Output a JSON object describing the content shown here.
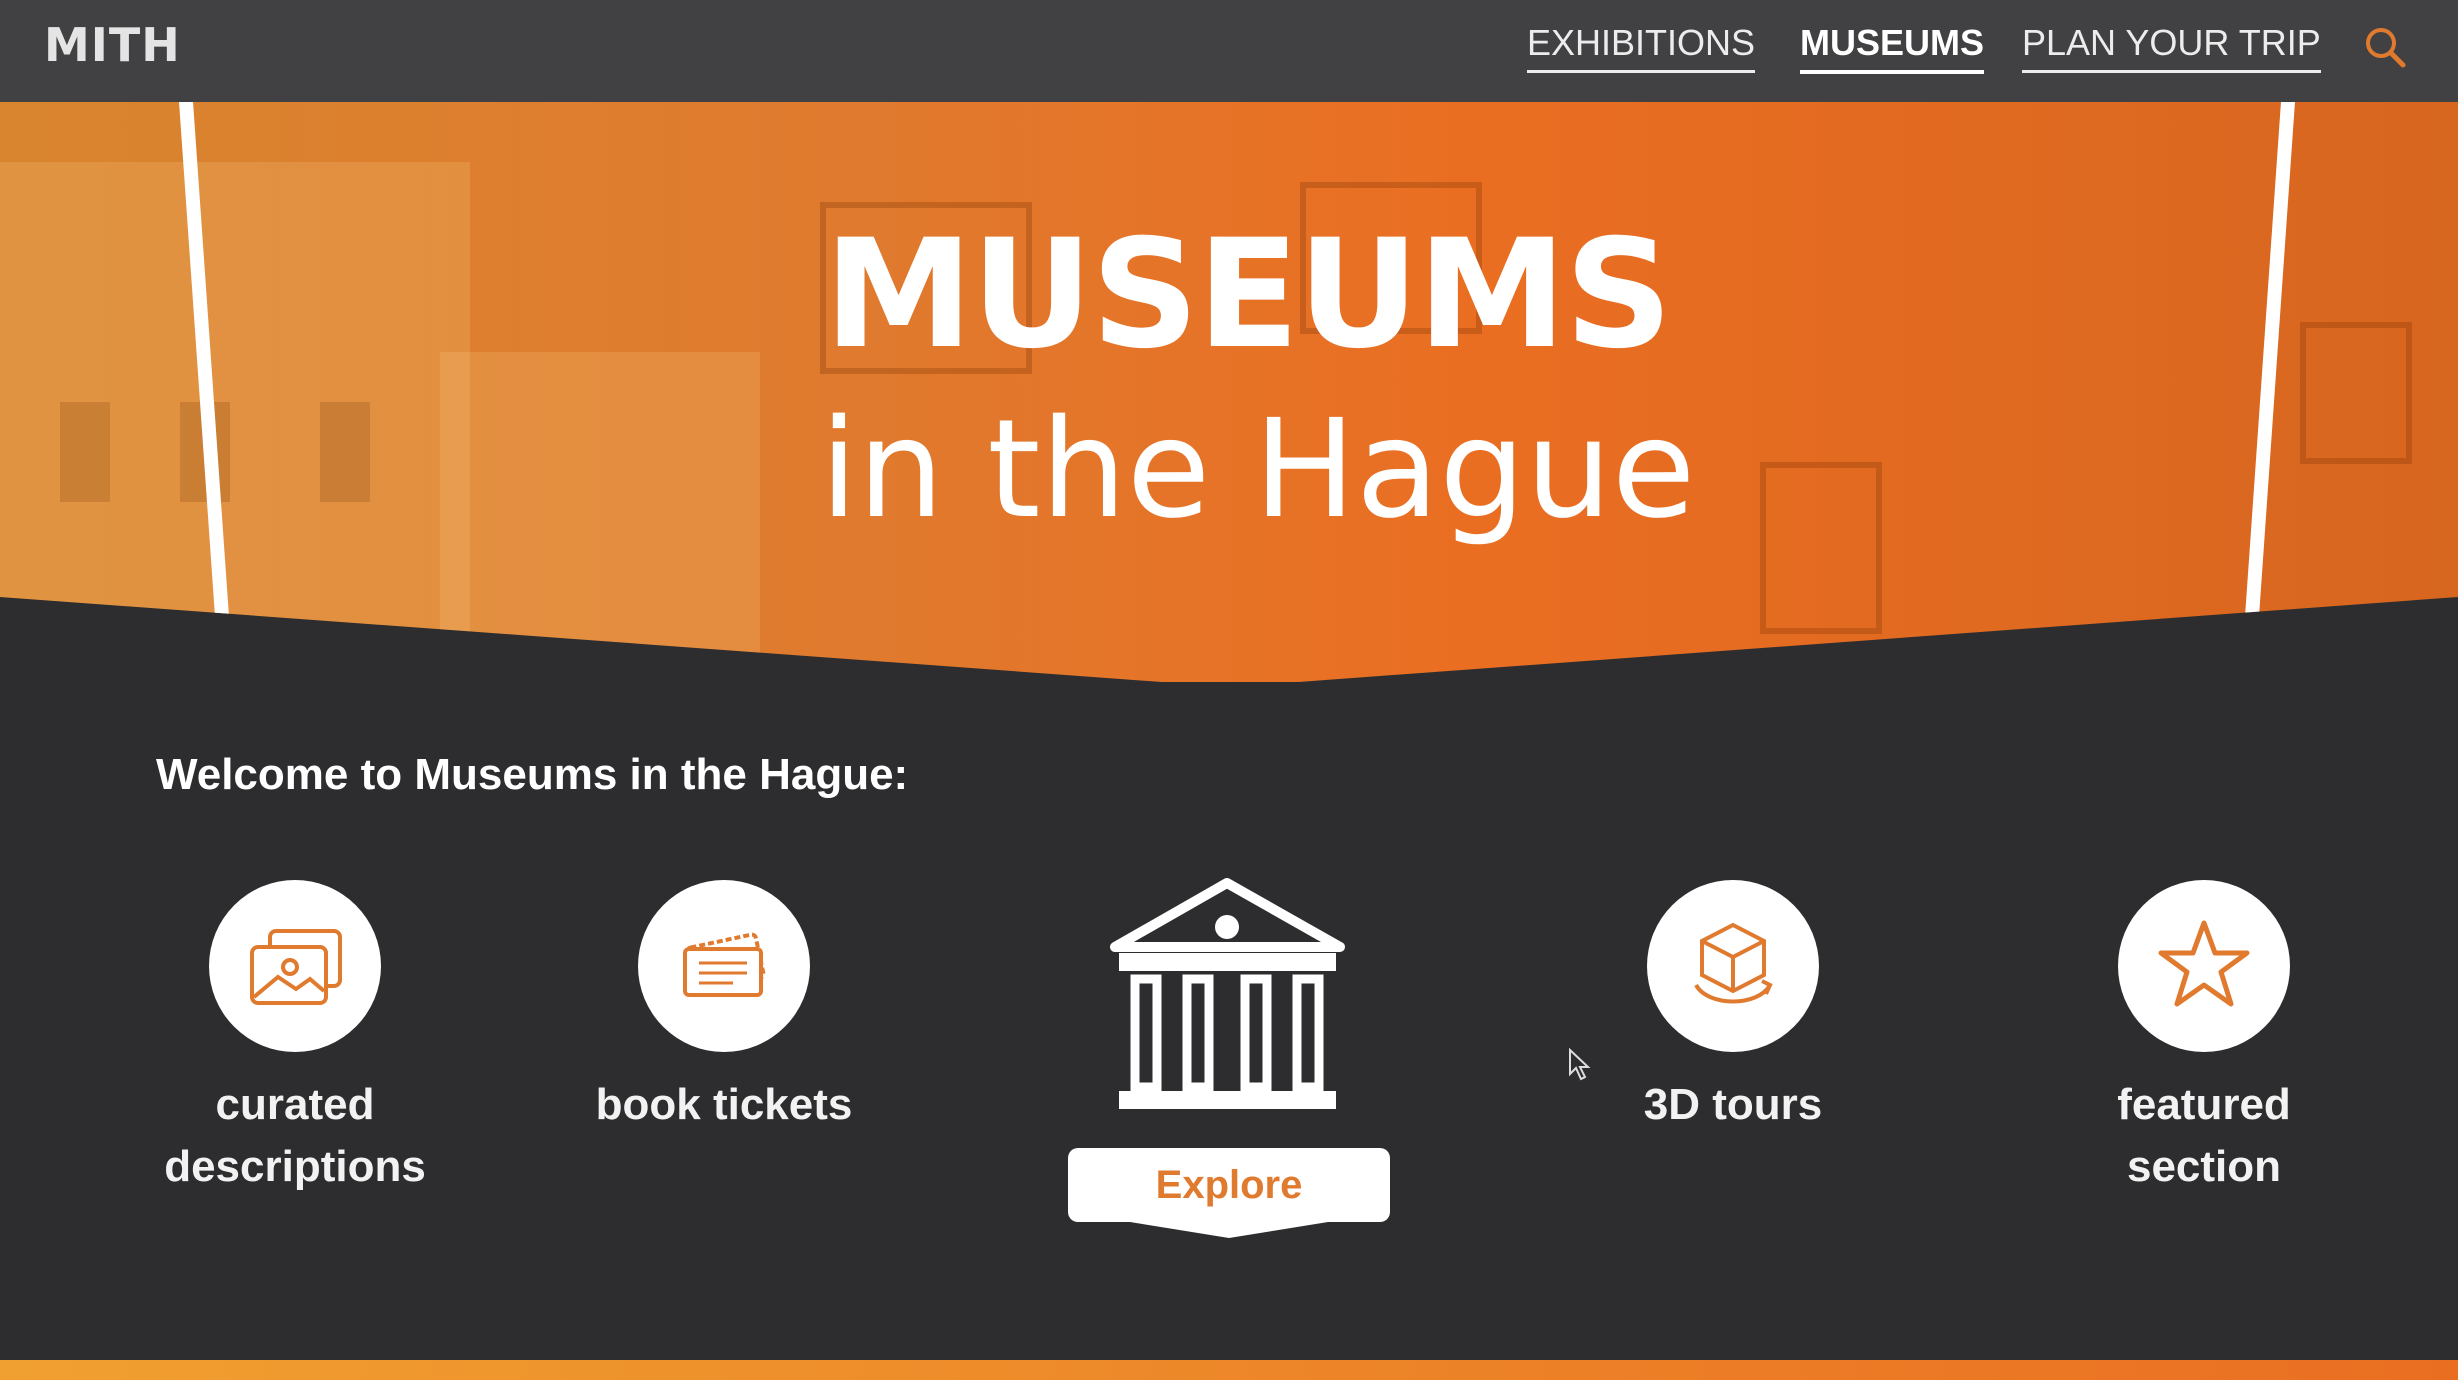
{
  "nav": {
    "logo": "MITH",
    "links": [
      {
        "label": "EXHIBITIONS",
        "active": false
      },
      {
        "label": "MUSEUMS",
        "active": true
      },
      {
        "label": "PLAN YOUR TRIP",
        "active": false
      }
    ],
    "search_icon": "search-icon"
  },
  "hero": {
    "title": "MUSEUMS",
    "subtitle": "in the Hague"
  },
  "content": {
    "welcome": "Welcome to Museums in the Hague:",
    "features": [
      {
        "label": "curated descriptions",
        "icon": "pictures-icon"
      },
      {
        "label": "book tickets",
        "icon": "tickets-icon"
      },
      {
        "label": "3D tours",
        "icon": "3d-cube-icon"
      },
      {
        "label": "featured section",
        "icon": "star-icon"
      }
    ],
    "center": {
      "icon": "museum-icon",
      "button_label": "Explore"
    }
  },
  "colors": {
    "accent": "#e07a2e",
    "nav_bg": "#414143",
    "page_bg": "#2d2d2f"
  }
}
